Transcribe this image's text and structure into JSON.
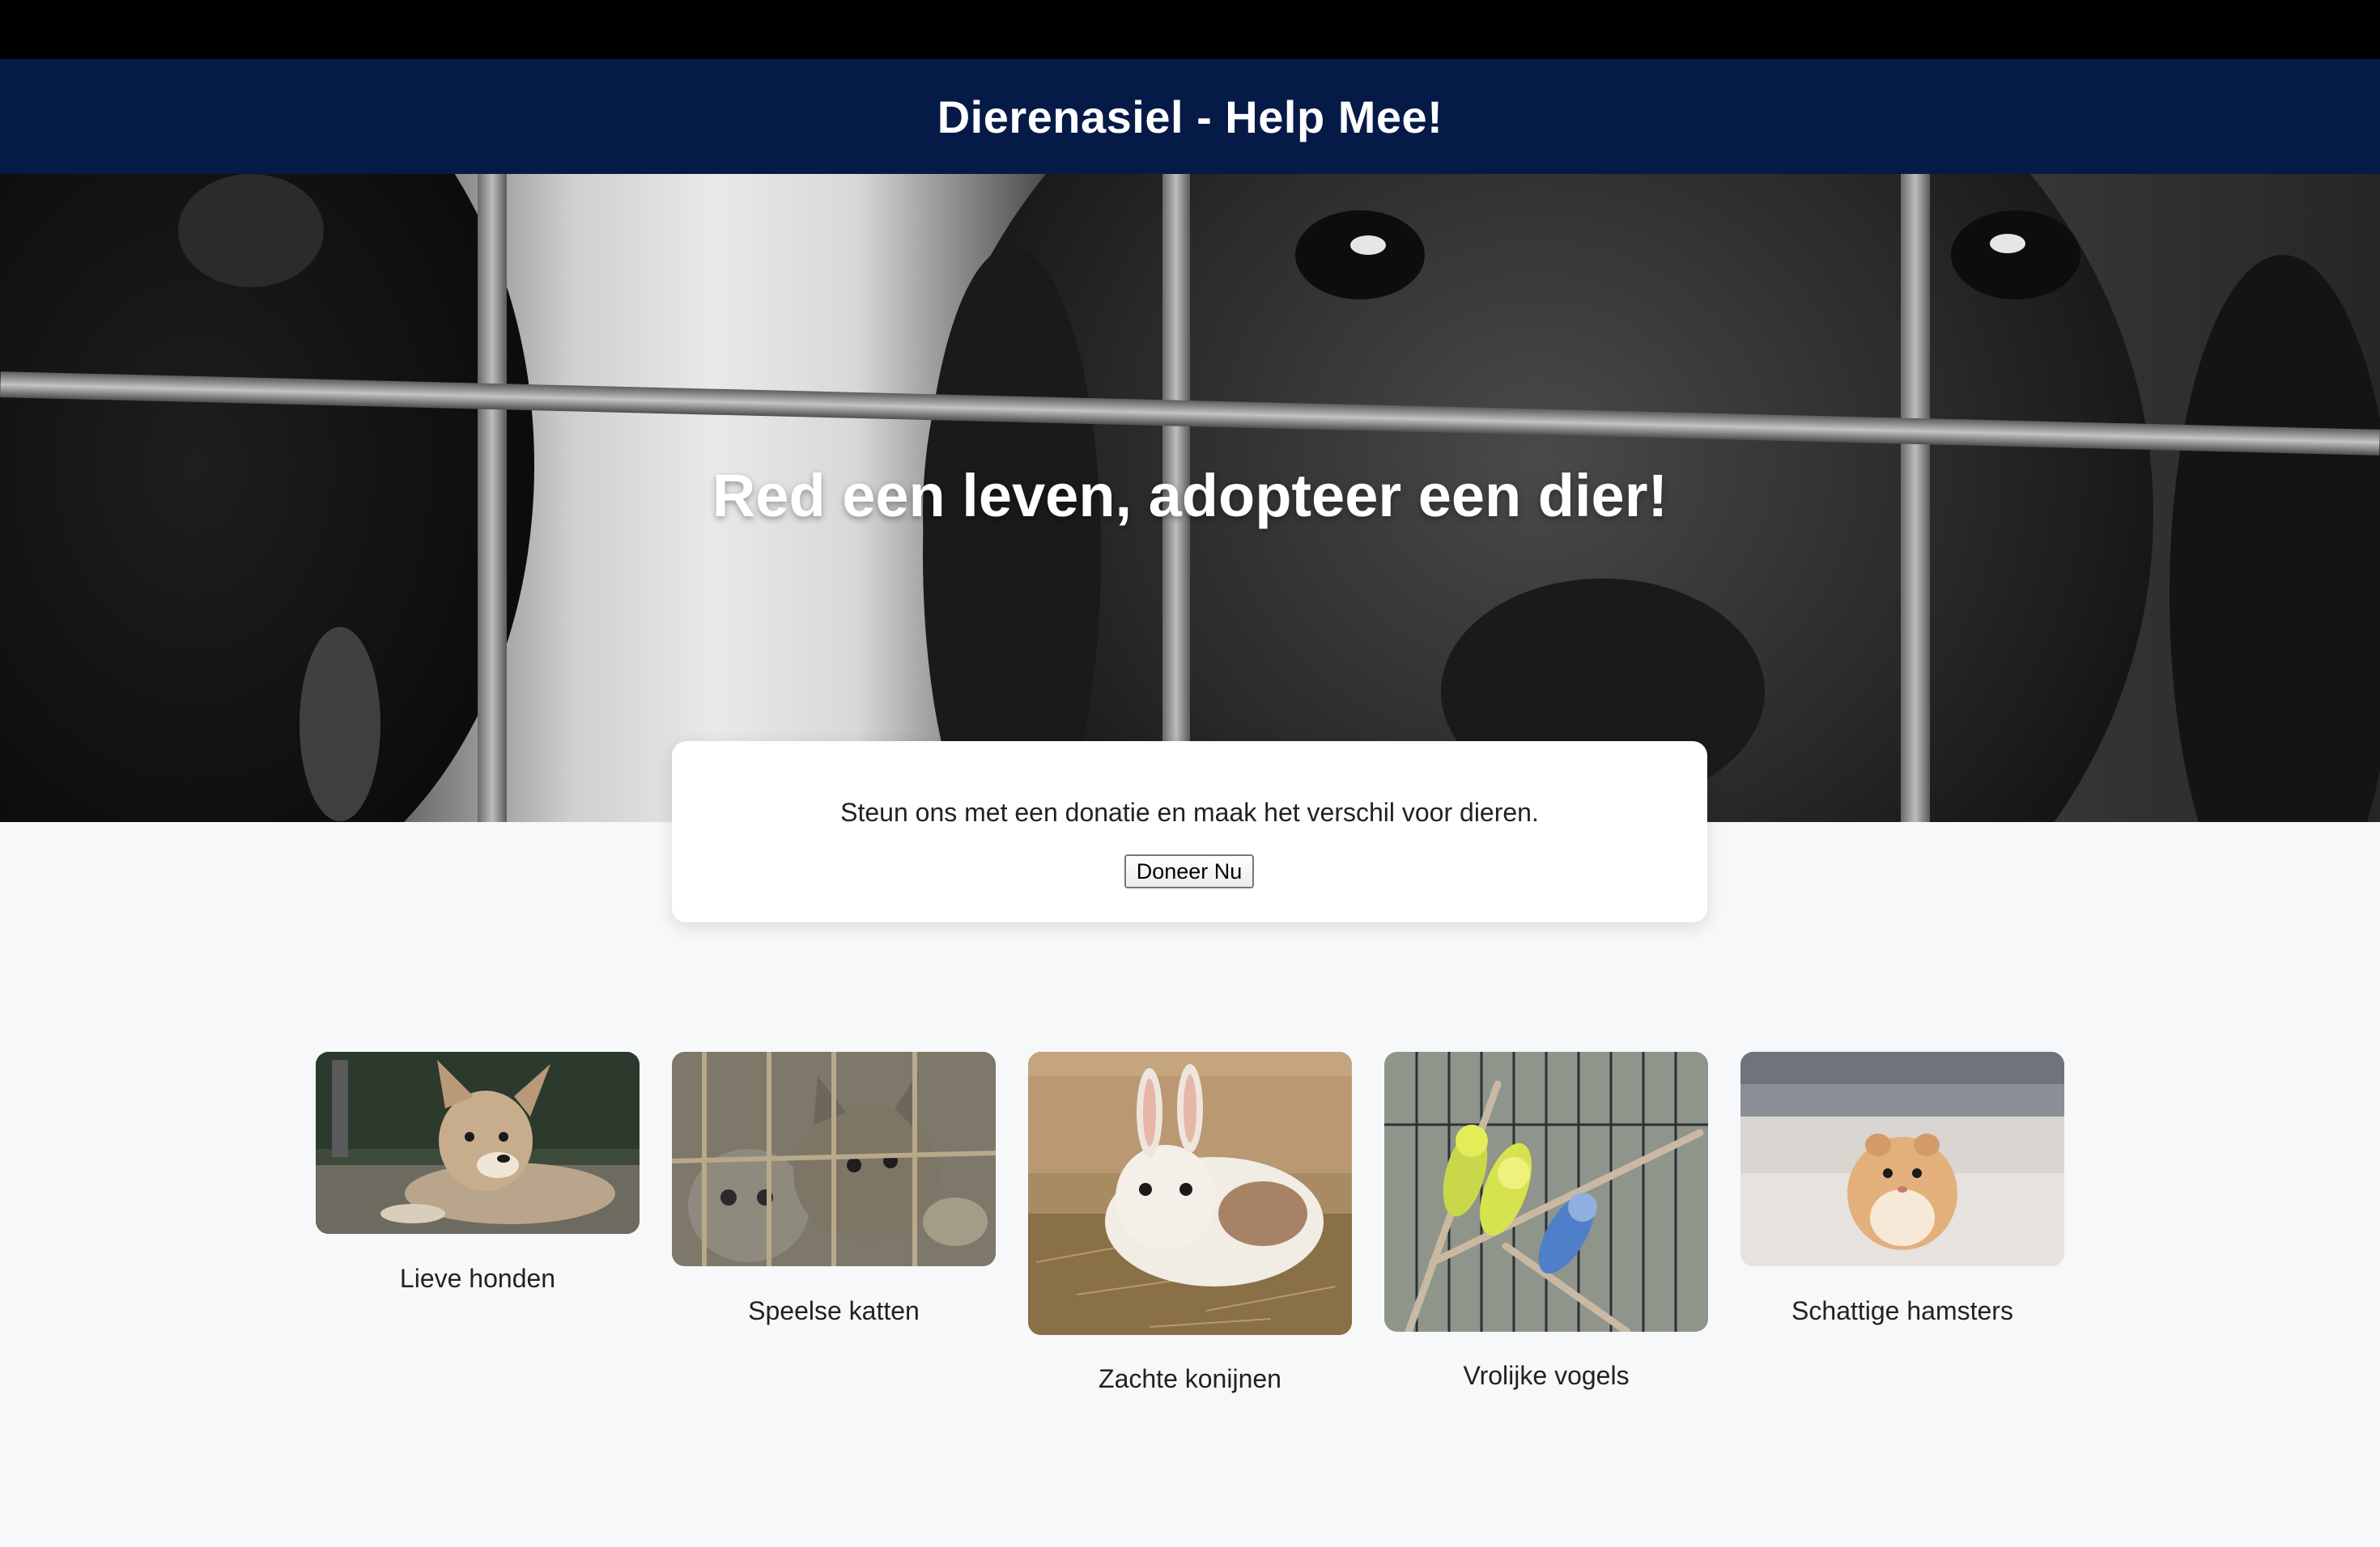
{
  "header": {
    "title": "Dierenasiel - Help Mee!"
  },
  "hero": {
    "headline": "Red een leven, adopteer een dier!",
    "image_icon": "caged-dogs-photo"
  },
  "donation": {
    "text": "Steun ons met een donatie en maak het verschil voor dieren.",
    "button_label": "Doneer Nu"
  },
  "animals": [
    {
      "label": "Lieve honden",
      "icon": "puppy-photo"
    },
    {
      "label": "Speelse katten",
      "icon": "kittens-photo"
    },
    {
      "label": "Zachte konijnen",
      "icon": "rabbit-photo"
    },
    {
      "label": "Vrolijke vogels",
      "icon": "parakeets-photo"
    },
    {
      "label": "Schattige hamsters",
      "icon": "hamster-photo"
    }
  ],
  "colors": {
    "header_bg": "#061a48",
    "page_bg": "#f7f8fa",
    "top_strip": "#000000"
  }
}
